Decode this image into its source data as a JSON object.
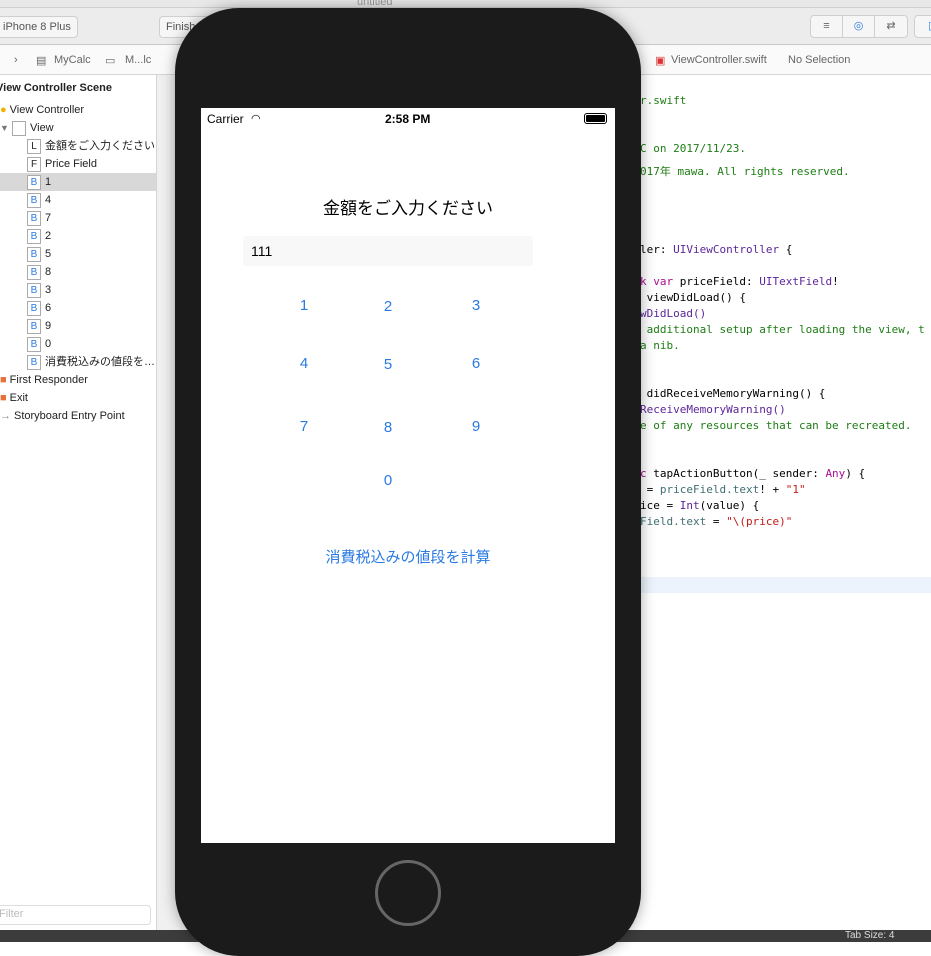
{
  "window": {
    "title": "untitled"
  },
  "toolbar": {
    "device": "iPhone 8 Plus",
    "status": "Finished"
  },
  "breadcrumb": {
    "items": [
      "MyCalc",
      "M...lc",
      "ViewController.swift",
      "No Selection"
    ]
  },
  "navigator": {
    "scene": "View Controller Scene",
    "items": [
      {
        "badge": "",
        "label": "View Controller"
      },
      {
        "badge": "",
        "label": "View"
      },
      {
        "badge": "L",
        "label": "金額をご入力ください"
      },
      {
        "badge": "F",
        "label": "Price Field"
      },
      {
        "badge": "B",
        "label": "1"
      },
      {
        "badge": "B",
        "label": "4"
      },
      {
        "badge": "B",
        "label": "7"
      },
      {
        "badge": "B",
        "label": "2"
      },
      {
        "badge": "B",
        "label": "5"
      },
      {
        "badge": "B",
        "label": "8"
      },
      {
        "badge": "B",
        "label": "3"
      },
      {
        "badge": "B",
        "label": "6"
      },
      {
        "badge": "B",
        "label": "9"
      },
      {
        "badge": "B",
        "label": "0"
      },
      {
        "badge": "B",
        "label": "消費税込みの値段を…"
      },
      {
        "badge": "",
        "label": "First Responder"
      },
      {
        "badge": "",
        "label": "Exit"
      },
      {
        "badge": "",
        "label": "Storyboard Entry Point"
      }
    ],
    "filter_placeholder": "Filter"
  },
  "code": {
    "l1": "r.swift",
    "l2": "C on 2017/11/23.",
    "l3": "017年 mawa. All rights reserved.",
    "l4a": "ler: ",
    "l4b": "UIViewController",
    "l4c": " {",
    "l5a": "k var ",
    "l5b": "priceField: ",
    "l5c": "UITextField",
    "l5d": "!",
    "l6": " viewDidLoad() {",
    "l7": "wDidLoad()",
    "l8": " additional setup after loading the view, t",
    "l9": "a nib.",
    "l10": " didReceiveMemoryWarning() {",
    "l11": "ReceiveMemoryWarning()",
    "l12": "e of any resources that can be recreated.",
    "l13a": "c",
    "l13b": " tapActionButton(_ sender: ",
    "l13c": "Any",
    "l13d": ") {",
    "l14a": " = ",
    "l14b": "priceField.text",
    "l14c": "! + ",
    "l14d": "\"1\"",
    "l15a": "ice = ",
    "l15b": "Int",
    "l15c": "(value) {",
    "l16a": "Field.text",
    "l16b": " = ",
    "l16c": "\"\\(price)\""
  },
  "simulator": {
    "carrier": "Carrier",
    "time": "2:58 PM",
    "prompt": "金額をご入力ください",
    "price_value": "111",
    "keys": [
      "1",
      "2",
      "3",
      "4",
      "5",
      "6",
      "7",
      "8",
      "9",
      "0"
    ],
    "calc_button": "消費税込みの値段を計算"
  },
  "statusbar": {
    "tab_size": "Tab Size: 4"
  }
}
